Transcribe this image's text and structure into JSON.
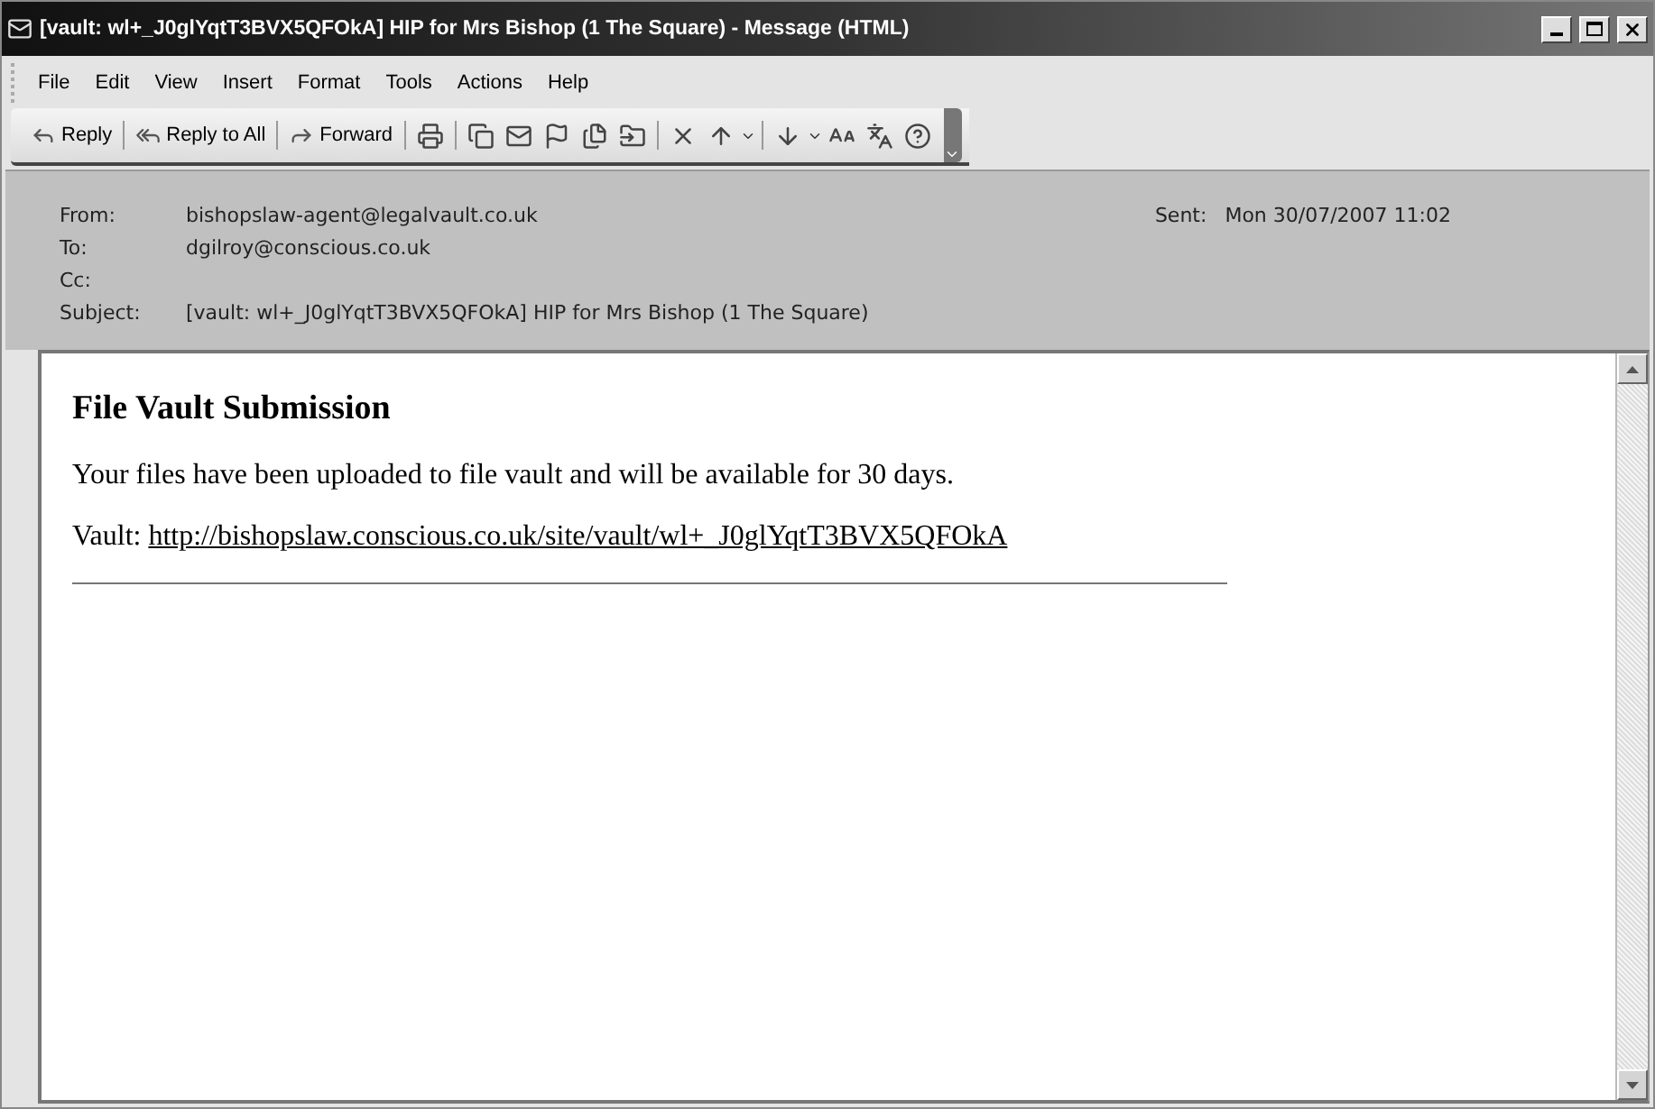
{
  "window": {
    "title": "[vault: wl+_J0glYqtT3BVX5QFOkA] HIP for Mrs Bishop (1 The Square) - Message (HTML)"
  },
  "menu": [
    "File",
    "Edit",
    "View",
    "Insert",
    "Format",
    "Tools",
    "Actions",
    "Help"
  ],
  "toolbar": {
    "buttons": [
      "Reply",
      "Reply to All",
      "Forward"
    ]
  },
  "header": {
    "from_label": "From:",
    "from": "bishopslaw-agent@legalvault.co.uk",
    "sent_label": "Sent:",
    "sent": "Mon 30/07/2007 11:02",
    "to_label": "To:",
    "to": "dgilroy@conscious.co.uk",
    "cc_label": "Cc:",
    "subject_label": "Subject:",
    "subject": "[vault: wl+_J0glYqtT3BVX5QFOkA] HIP for Mrs Bishop (1 The Square)"
  },
  "body": {
    "heading": "File Vault Submission",
    "text": "Your files have been uploaded to file vault and will be available for 30 days.",
    "vault_label": "Vault:",
    "vault_link": "http://bishopslaw.conscious.co.uk/site/vault/wl+_J0glYqtT3BVX5QFOkA"
  }
}
